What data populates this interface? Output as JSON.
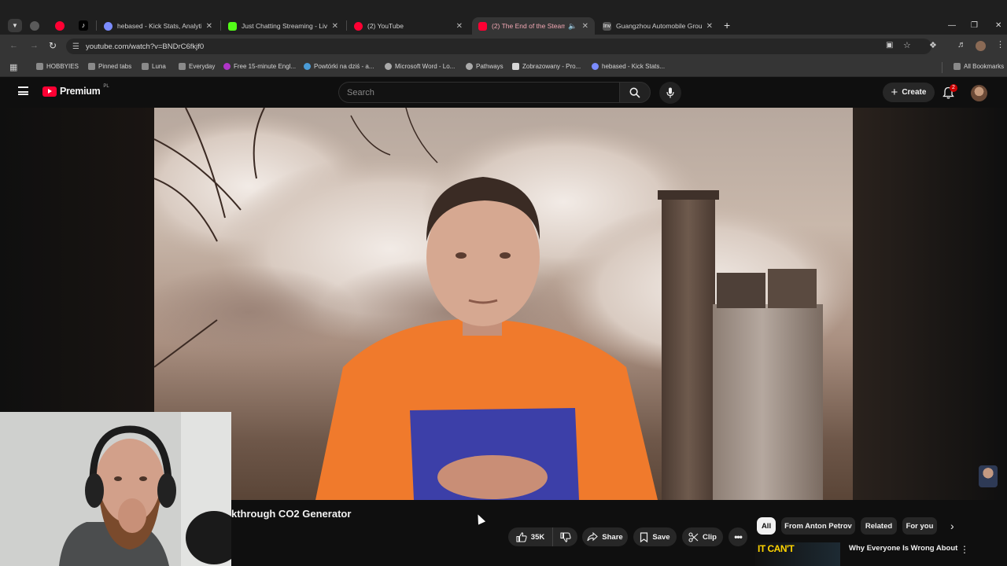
{
  "browser": {
    "tabs": [
      {
        "title": "hebased - Kick Stats, Analytics",
        "color": "#7b8cff"
      },
      {
        "title": "Just Chatting Streaming - Live",
        "color": "#53fc18"
      },
      {
        "title": "(2) YouTube",
        "color": "#ff0033"
      },
      {
        "title": "(2) The End of the Steam A",
        "color": "#ff0033"
      },
      {
        "title": "Guangzhou Automobile Group",
        "color": "#555555"
      }
    ],
    "url": "youtube.com/watch?v=BNDrC6fkjf0",
    "bookmarks": [
      "HOBBYIES",
      "Pinned tabs",
      "Luna",
      "Everyday",
      "Free 15-minute Engl...",
      "Powtórki na dziś - a...",
      "Microsoft Word - Lo...",
      "Pathways",
      "Zobrazowany - Pro...",
      "hebased - Kick Stats..."
    ],
    "all_bookmarks": "All Bookmarks"
  },
  "youtube": {
    "logo_text": "Premium",
    "region": "PL",
    "search_placeholder": "Search",
    "create_label": "Create",
    "notification_count": "2",
    "video_title": "kthrough CO2 Generator",
    "likes": "35K",
    "share_label": "Share",
    "save_label": "Save",
    "clip_label": "Clip",
    "chips": [
      "All",
      "From Anton Petrov",
      "Related",
      "For you"
    ],
    "recommended": {
      "title": "Why Everyone Is Wrong About",
      "thumb_text": "IT CAN'T"
    }
  },
  "colors": {
    "yt_red": "#ff0033",
    "background": "#0f0f0f"
  }
}
